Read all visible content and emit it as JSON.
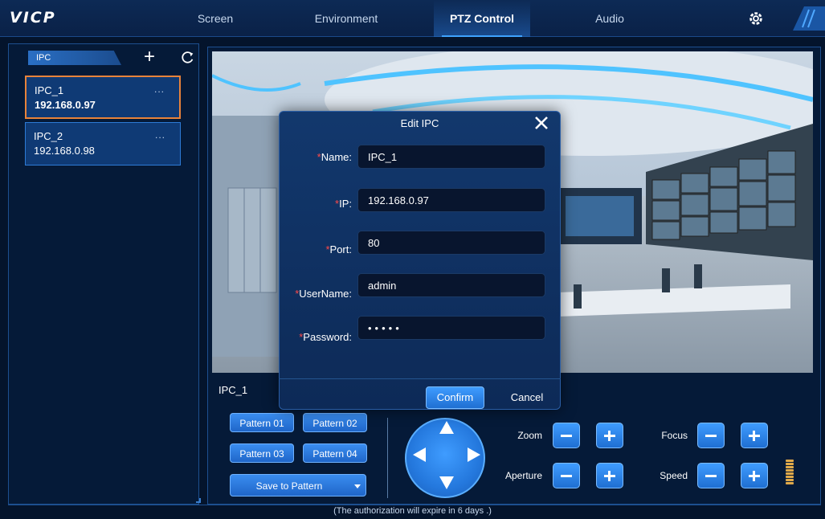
{
  "app": {
    "logo": "VICP"
  },
  "nav": {
    "tabs": [
      {
        "label": "Screen",
        "active": false
      },
      {
        "label": "Environment",
        "active": false
      },
      {
        "label": "PTZ Control",
        "active": true
      },
      {
        "label": "Audio",
        "active": false
      }
    ],
    "settings_icon": "gear-icon"
  },
  "sidebar": {
    "header": "IPC",
    "add_icon": "plus-icon",
    "refresh_icon": "refresh-icon",
    "devices": [
      {
        "name": "IPC_1",
        "ip": "192.168.0.97",
        "more": "...",
        "selected": true
      },
      {
        "name": "IPC_2",
        "ip": "192.168.0.98",
        "more": "...",
        "selected": false
      }
    ]
  },
  "preview": {
    "camera_name": "IPC_1"
  },
  "patterns": {
    "buttons": [
      "Pattern 01",
      "Pattern 02",
      "Pattern 03",
      "Pattern 04"
    ],
    "save_label": "Save to Pattern"
  },
  "ptz": {
    "zoom_label": "Zoom",
    "aperture_label": "Aperture",
    "focus_label": "Focus",
    "speed_label": "Speed",
    "speed_level_bars": 8
  },
  "footer": {
    "note": "(The authorization will expire in 6 days .)"
  },
  "modal": {
    "title": "Edit IPC",
    "required_mark": "*",
    "fields": [
      {
        "label": "Name:",
        "value": "IPC_1"
      },
      {
        "label": "IP:",
        "value": "192.168.0.97"
      },
      {
        "label": "Port:",
        "value": "80"
      },
      {
        "label": "UserName:",
        "value": "admin"
      },
      {
        "label": "Password:",
        "value": "•••••"
      }
    ],
    "confirm_label": "Confirm",
    "cancel_label": "Cancel"
  },
  "colors": {
    "accent": "#2f8cf0",
    "selected_border": "#e8833a",
    "required": "#ff4a4a",
    "speed_meter": "#e0a94a"
  }
}
